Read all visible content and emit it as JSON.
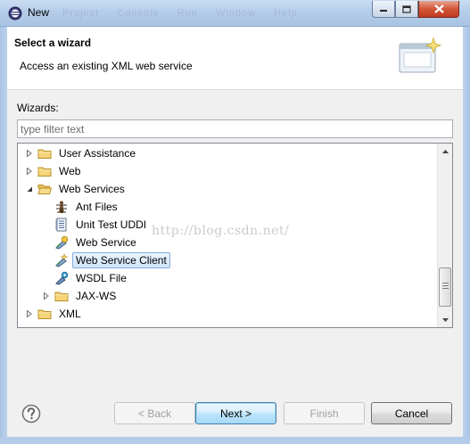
{
  "window": {
    "title": "New",
    "ghost_menu": [
      "Project",
      "Console",
      "Run",
      "Window",
      "Help"
    ]
  },
  "header": {
    "title": "Select a wizard",
    "description": "Access an existing XML web service"
  },
  "content": {
    "wizards_label": "Wizards:",
    "filter_placeholder": "type filter text"
  },
  "tree": {
    "items": [
      {
        "label": "User Assistance",
        "icon": "folder-icon",
        "level": 0,
        "expandable": true,
        "expanded": false,
        "selected": false
      },
      {
        "label": "Web",
        "icon": "folder-icon",
        "level": 0,
        "expandable": true,
        "expanded": false,
        "selected": false
      },
      {
        "label": "Web Services",
        "icon": "folder-icon",
        "level": 0,
        "expandable": true,
        "expanded": true,
        "selected": false
      },
      {
        "label": "Ant Files",
        "icon": "ant-icon",
        "level": 1,
        "expandable": false,
        "selected": false
      },
      {
        "label": "Unit Test UDDI",
        "icon": "uddi-file-icon",
        "level": 1,
        "expandable": false,
        "selected": false
      },
      {
        "label": "Web Service",
        "icon": "web-service-icon",
        "level": 1,
        "expandable": false,
        "selected": false
      },
      {
        "label": "Web Service Client",
        "icon": "web-service-client-icon",
        "level": 1,
        "expandable": false,
        "selected": true
      },
      {
        "label": "WSDL File",
        "icon": "wsdl-file-icon",
        "level": 1,
        "expandable": false,
        "selected": false
      },
      {
        "label": "JAX-WS",
        "icon": "folder-icon",
        "level": 1,
        "expandable": true,
        "expanded": false,
        "selected": false
      },
      {
        "label": "XML",
        "icon": "folder-icon",
        "level": 0,
        "expandable": true,
        "expanded": false,
        "selected": false
      }
    ]
  },
  "watermark": "http://blog.csdn.net/",
  "buttons": {
    "back": "< Back",
    "next": "Next >",
    "finish": "Finish",
    "cancel": "Cancel"
  },
  "colors": {
    "selection_fill": "#cfe5fb",
    "selection_border": "#84acdd",
    "folder": "#e8c45c",
    "titlebar": "#b5cde9"
  }
}
